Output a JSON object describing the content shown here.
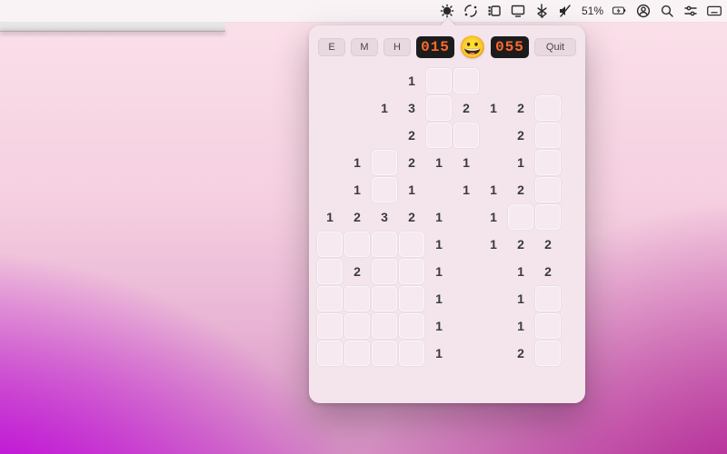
{
  "menubar": {
    "battery_text": "51%"
  },
  "game": {
    "difficulty": {
      "easy": "E",
      "medium": "M",
      "hard": "H"
    },
    "mine_counter": "015",
    "timer": "055",
    "face": "😀",
    "quit_label": "Quit",
    "cols": 9,
    "rows": 12,
    "cells": [
      [
        "r",
        "r",
        "r",
        "r1",
        "c",
        "c",
        "r",
        "r",
        "r"
      ],
      [
        "r",
        "r",
        "r1",
        "r3",
        "c",
        "r2",
        "r1",
        "r2",
        "c"
      ],
      [
        "r",
        "r",
        "r",
        "r2",
        "c",
        "c",
        "r",
        "r2",
        "c"
      ],
      [
        "r",
        "r1",
        "c",
        "r2",
        "r1",
        "r1",
        "r",
        "r1",
        "c"
      ],
      [
        "r",
        "r1",
        "c",
        "r1",
        "r",
        "r1",
        "r1",
        "r2",
        "c"
      ],
      [
        "r1",
        "r2",
        "r3",
        "r2",
        "r1",
        "r",
        "r1",
        "c",
        "c"
      ],
      [
        "c",
        "c",
        "c",
        "c",
        "r1",
        "r",
        "r1",
        "r2",
        "r2"
      ],
      [
        "c",
        "r2",
        "c",
        "c",
        "r1",
        "r",
        "r",
        "r1",
        "r2"
      ],
      [
        "c",
        "c",
        "c",
        "c",
        "r1",
        "r",
        "r",
        "r1",
        "c"
      ],
      [
        "c",
        "c",
        "c",
        "c",
        "r1",
        "r",
        "r",
        "r1",
        "c"
      ],
      [
        "c",
        "c",
        "c",
        "c",
        "r1",
        "r",
        "r",
        "r2",
        "c"
      ],
      [
        "r",
        "r",
        "r",
        "r",
        "r",
        "r",
        "r",
        "r",
        "r"
      ]
    ]
  }
}
